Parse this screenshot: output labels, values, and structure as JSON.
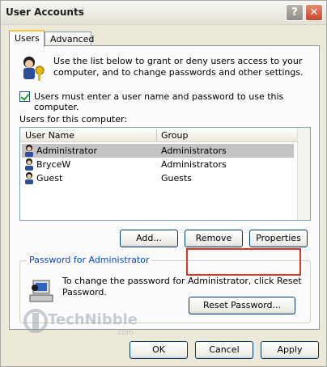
{
  "window": {
    "title": "User Accounts",
    "help_glyph": "?",
    "close_glyph": "✕"
  },
  "tabs": [
    {
      "label": "Users",
      "active": true
    },
    {
      "label": "Advanced",
      "active": false
    }
  ],
  "users_tab": {
    "intro": "Use the list below to grant or deny users access to your computer, and to change passwords and other settings.",
    "require_login_label": "Users must enter a user name and password to use this computer.",
    "require_login_checked": true,
    "users_label": "Users for this computer:",
    "columns": [
      "User Name",
      "Group"
    ],
    "users": [
      {
        "name": "Administrator",
        "group": "Administrators",
        "selected": true
      },
      {
        "name": "BryceW",
        "group": "Administrators",
        "selected": false
      },
      {
        "name": "Guest",
        "group": "Guests",
        "selected": false
      }
    ],
    "buttons": {
      "add": "Add...",
      "remove": "Remove",
      "properties": "Properties"
    }
  },
  "password_group": {
    "legend": "Password for Administrator",
    "text": "To change the password for Administrator, click Reset Password.",
    "reset_button": "Reset Password..."
  },
  "dialog_buttons": {
    "ok": "OK",
    "cancel": "Cancel",
    "apply": "Apply"
  },
  "watermark": {
    "text": "TechNibble",
    "sub": ".com"
  },
  "colors": {
    "accent_tab": "#ffc83c",
    "highlight": "#e0341c",
    "legend": "#0046d5"
  }
}
